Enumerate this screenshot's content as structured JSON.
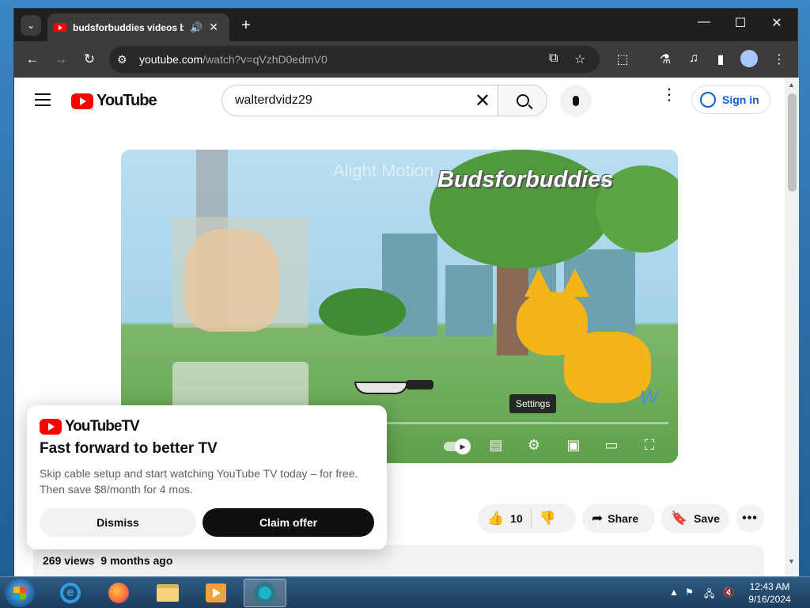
{
  "browser": {
    "tab_title": "budsforbuddies videos be",
    "url_host": "youtube.com",
    "url_path": "/watch?v=qVzhD0edmV0"
  },
  "youtube": {
    "logo_text": "YouTube",
    "search_value": "walterdvidz29",
    "signin_label": "Sign in"
  },
  "video": {
    "title_overlay": "Budsforbuddies",
    "ghost_text": "Alight Motion",
    "watermark": "W",
    "tooltip": "Settings"
  },
  "actions": {
    "like_count": "10",
    "share_label": "Share",
    "save_label": "Save"
  },
  "meta": {
    "views": "269 views",
    "age": "9 months ago"
  },
  "promo": {
    "brand": "YouTubeTV",
    "heading": "Fast forward to better TV",
    "body": "Skip cable setup and start watching YouTube TV today – for free. Then save $8/month for 4 mos.",
    "dismiss_label": "Dismiss",
    "claim_label": "Claim offer"
  },
  "taskbar": {
    "time": "12:43 AM",
    "date": "9/16/2024"
  },
  "colors": {
    "youtube_red": "#ff0000",
    "link_blue": "#065fd4",
    "chrome_dark": "#1f1f1f"
  }
}
